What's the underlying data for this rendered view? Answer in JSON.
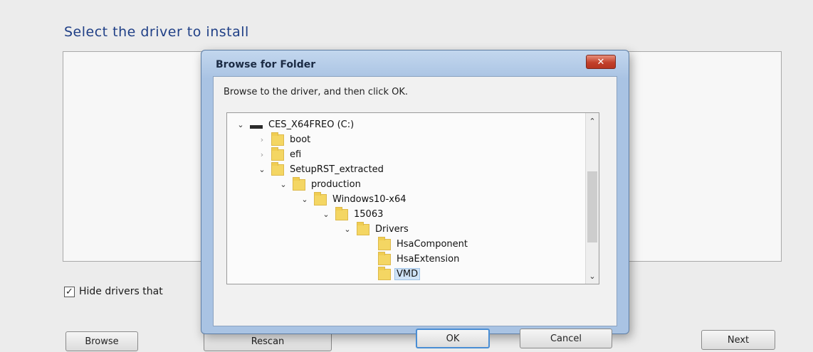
{
  "page": {
    "title": "Select the driver to install",
    "hide_drivers_label": "Hide drivers that",
    "hide_drivers_checked": true
  },
  "buttons": {
    "browse": "Browse",
    "rescan": "Rescan",
    "next": "Next"
  },
  "dialog": {
    "title": "Browse for Folder",
    "close": "✕",
    "instruction": "Browse to the driver, and then click OK.",
    "ok": "OK",
    "cancel": "Cancel",
    "tree": [
      {
        "label": "CES_X64FREO (C:)",
        "state": "expanded",
        "type": "drive"
      },
      {
        "label": "boot",
        "state": "collapsed",
        "type": "folder"
      },
      {
        "label": "efi",
        "state": "collapsed",
        "type": "folder"
      },
      {
        "label": "SetupRST_extracted",
        "state": "expanded",
        "type": "folder"
      },
      {
        "label": "production",
        "state": "expanded",
        "type": "folder"
      },
      {
        "label": "Windows10-x64",
        "state": "expanded",
        "type": "folder"
      },
      {
        "label": "15063",
        "state": "expanded",
        "type": "folder"
      },
      {
        "label": "Drivers",
        "state": "expanded",
        "type": "folder"
      },
      {
        "label": "HsaComponent",
        "state": "leaf",
        "type": "folder"
      },
      {
        "label": "HsaExtension",
        "state": "leaf",
        "type": "folder"
      },
      {
        "label": "VMD",
        "state": "leaf",
        "type": "folder",
        "selected": true
      }
    ]
  },
  "icons": {
    "chevron_expanded": "chevron-down-icon",
    "chevron_collapsed": "chevron-right-icon",
    "folder": "folder-icon",
    "drive": "drive-icon",
    "close": "close-icon",
    "scroll_up": "chevron-up-icon",
    "scroll_down": "chevron-down-icon",
    "cursor": "mouse-pointer-icon"
  },
  "colors": {
    "title_text": "#1f3f86",
    "dialog_frame": "#a9c3e3",
    "close_button": "#c2412b",
    "folder": "#f4d663",
    "selection": "#cfe3f7"
  }
}
